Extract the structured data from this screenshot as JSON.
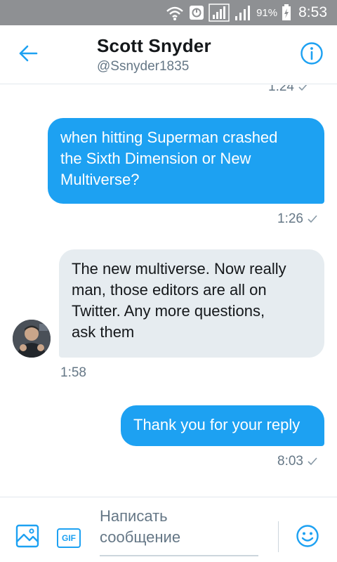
{
  "status_bar": {
    "battery_percent": "91%",
    "clock": "8:53",
    "icons": [
      "wifi-hotspot-icon",
      "vpn-icon",
      "signal-icon",
      "signal-icon",
      "battery-charging-icon"
    ]
  },
  "header": {
    "name": "Scott Snyder",
    "handle": "@Ssnyder1835",
    "back_icon": "arrow-left-icon",
    "info_icon": "info-icon"
  },
  "messages": [
    {
      "direction": "sent",
      "text": "",
      "time": "1:24",
      "read": true
    },
    {
      "direction": "sent",
      "text": "when hitting Superman crashed\nthe Sixth Dimension or New\nMultiverse?",
      "time": "1:26",
      "read": true
    },
    {
      "direction": "received",
      "text": "The new multiverse. Now really\nman, those editors are all on\nTwitter. Any more questions,\nask them",
      "time": "1:58"
    },
    {
      "direction": "sent",
      "text": "Thank you for your reply",
      "time": "8:03",
      "read": true
    }
  ],
  "composer": {
    "placeholder": "Написать\nсообщение",
    "image_icon": "image-icon",
    "gif_label": "GIF",
    "emoji_icon": "emoji-icon"
  },
  "colors": {
    "accent": "#1da1f2",
    "sent_bubble": "#1da1f2",
    "received_bubble": "#e6ecf0",
    "status_bar": "#8e9093",
    "meta_text": "#657786"
  }
}
